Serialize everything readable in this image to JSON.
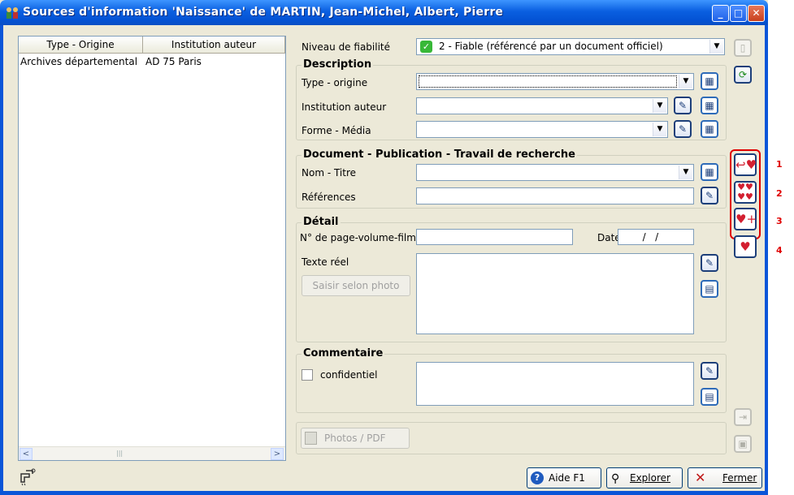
{
  "window": {
    "title": "Sources d'information  'Naissance'  de MARTIN, Jean-Michel, Albert, Pierre",
    "min": "_",
    "max": "□",
    "close": "✕"
  },
  "left_list": {
    "columns": [
      "Type - Origine",
      "Institution auteur"
    ],
    "rows": [
      [
        "Archives départemental",
        "AD 75 Paris"
      ]
    ],
    "scroll_left": "<",
    "scroll_right": ">",
    "scroll_thumb": "|||"
  },
  "fiabilite": {
    "label": "Niveau de fiabilité",
    "value": "2 - Fiable (référencé par un document officiel)",
    "check": "✓"
  },
  "description": {
    "title": "Description",
    "type_origine_label": "Type - origine",
    "institution_label": "Institution auteur",
    "forme_label": "Forme - Média"
  },
  "document": {
    "title": "Document - Publication - Travail de recherche",
    "nom_label": "Nom - Titre",
    "references_label": "Références"
  },
  "detail": {
    "title": "Détail",
    "page_label": "N° de page-volume-film",
    "date_label": "Date",
    "date_value": "  /   /",
    "texte_label": "Texte réel",
    "saisir_button": "Saisir selon photo"
  },
  "commentaire": {
    "title": "Commentaire",
    "confidentiel_label": "confidentiel"
  },
  "photos_button": "Photos / PDF",
  "numbers": [
    "1",
    "2",
    "3",
    "4"
  ],
  "buttons": {
    "aide": "Aide  F1",
    "explorer": "Explorer",
    "fermer": "Fermer"
  },
  "colors": {
    "title_bar": "#0a5fe0",
    "accent_red": "#e00000",
    "heart": "#d31f30"
  }
}
